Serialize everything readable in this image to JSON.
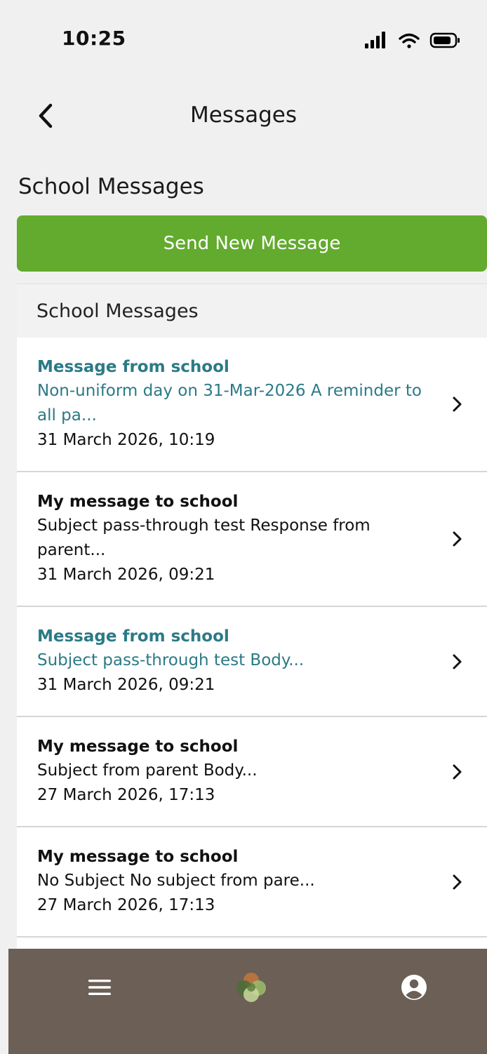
{
  "status_bar": {
    "time": "10:25"
  },
  "header": {
    "title": "Messages"
  },
  "section": {
    "heading": "School Messages"
  },
  "send_button": {
    "label": "Send New Message"
  },
  "panel": {
    "title": "School Messages"
  },
  "messages": [
    {
      "title": "Message from school",
      "preview": "Non-uniform day on 31-Mar-2026 A reminder to all pa...",
      "date": "31 March 2026, 10:19"
    },
    {
      "title": "My message to school",
      "preview": "Subject pass-through test Response from parent...",
      "date": "31 March 2026, 09:21"
    },
    {
      "title": "Message from school",
      "preview": "Subject pass-through test Body...",
      "date": "31 March 2026, 09:21"
    },
    {
      "title": "My message to school",
      "preview": "Subject from parent Body...",
      "date": "27 March 2026, 17:13"
    },
    {
      "title": "My message to school",
      "preview": "No Subject No subject from pare...",
      "date": "27 March 2026, 17:13"
    }
  ],
  "colors": {
    "accent_green": "#62ab2e",
    "school_message_teal": "#2b7a86",
    "nav_background": "#6b5f56"
  },
  "icons": {
    "back": "chevron-left-icon",
    "row": "chevron-right-icon",
    "nav_menu": "hamburger-menu-icon",
    "nav_home": "app-logo-icon",
    "nav_profile": "user-profile-icon"
  }
}
